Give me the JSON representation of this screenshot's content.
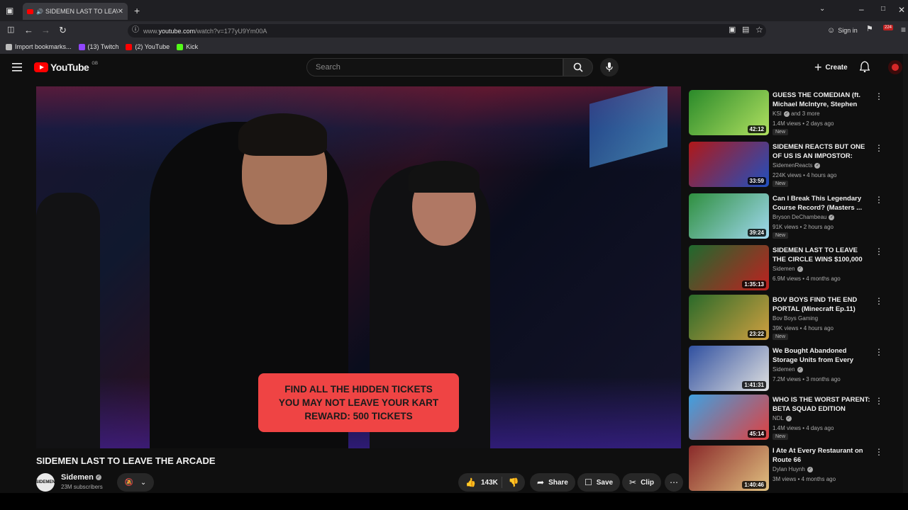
{
  "browser": {
    "tab_title": "SIDEMEN LAST TO LEAVE T",
    "url_prefix": "www.",
    "url_host": "youtube.com",
    "url_path": "/watch?v=177yU9Ym00A",
    "sign_in": "Sign in",
    "badge_count": "224",
    "bookmarks": [
      {
        "label": "Import bookmarks...",
        "color": "#bbbbbb"
      },
      {
        "label": "(13) Twitch",
        "color": "#9146ff"
      },
      {
        "label": "(2) YouTube",
        "color": "#ff0000"
      },
      {
        "label": "Kick",
        "color": "#53fc18"
      }
    ]
  },
  "header": {
    "logo_text": "YouTube",
    "logo_region": "GB",
    "search_placeholder": "Search",
    "create_label": "Create"
  },
  "video": {
    "caption_lines": [
      "FIND ALL THE HIDDEN TICKETS",
      "YOU MAY NOT LEAVE YOUR KART",
      "REWARD: 500 TICKETS"
    ],
    "title": "SIDEMEN LAST TO LEAVE THE ARCADE",
    "channel": "Sidemen",
    "channel_avatar_text": "SIDEMEN",
    "subscribers": "23M subscribers",
    "likes": "143K",
    "share_label": "Share",
    "save_label": "Save",
    "clip_label": "Clip"
  },
  "recommendations": [
    {
      "title": "GUESS THE COMEDIAN (ft. Michael McIntyre, Stephen Tri...",
      "channel": "KSI",
      "channel_suffix": "and 3 more",
      "verified": true,
      "meta": "1.4M views • 2 days ago",
      "new": "New",
      "duration": "42:12",
      "thumb_colors": [
        "#2a8a2a",
        "#b0e060"
      ]
    },
    {
      "title": "SIDEMEN REACTS BUT ONE OF US IS AN IMPOSTOR: TIKTOK ...",
      "channel": "SidemenReacts",
      "channel_suffix": "",
      "verified": true,
      "meta": "224K views • 4 hours ago",
      "new": "New",
      "duration": "33:59",
      "thumb_colors": [
        "#b01818",
        "#2050c0"
      ]
    },
    {
      "title": "Can I Break This Legendary Course Record? (Masters ...",
      "channel": "Bryson DeChambeau",
      "channel_suffix": "",
      "verified": true,
      "meta": "91K views • 2 hours ago",
      "new": "New",
      "duration": "39:24",
      "thumb_colors": [
        "#2f8f3f",
        "#a0d8f0"
      ]
    },
    {
      "title": "SIDEMEN LAST TO LEAVE THE CIRCLE WINS $100,000",
      "channel": "Sidemen",
      "channel_suffix": "",
      "verified": true,
      "meta": "6.9M views • 4 months ago",
      "new": "",
      "duration": "1:35:13",
      "thumb_colors": [
        "#1e6a2e",
        "#c02020"
      ]
    },
    {
      "title": "BOV BOYS FIND THE END PORTAL (Minecraft Ep.11)",
      "channel": "Bov Boys Gaming",
      "channel_suffix": "",
      "verified": false,
      "meta": "39K views • 4 hours ago",
      "new": "New",
      "duration": "23:22",
      "thumb_colors": [
        "#2a6a2a",
        "#d0a040"
      ]
    },
    {
      "title": "We Bought Abandoned Storage Units from Every Continent an...",
      "channel": "Sidemen",
      "channel_suffix": "",
      "verified": true,
      "meta": "7.2M views • 3 months ago",
      "new": "",
      "duration": "1:41:31",
      "thumb_colors": [
        "#3050a0",
        "#e0e0e0"
      ]
    },
    {
      "title": "WHO IS THE WORST PARENT: BETA SQUAD EDITION",
      "channel": "NDL",
      "channel_suffix": "",
      "verified": true,
      "meta": "1.4M views • 4 days ago",
      "new": "New",
      "duration": "45:14",
      "thumb_colors": [
        "#3fa0e0",
        "#e04040"
      ]
    },
    {
      "title": "I Ate At Every Restaurant on Route 66",
      "channel": "Dylan Huynh",
      "channel_suffix": "",
      "verified": true,
      "meta": "3M views • 4 months ago",
      "new": "",
      "duration": "1:40:46",
      "thumb_colors": [
        "#8a2a2a",
        "#e0c080"
      ]
    }
  ]
}
